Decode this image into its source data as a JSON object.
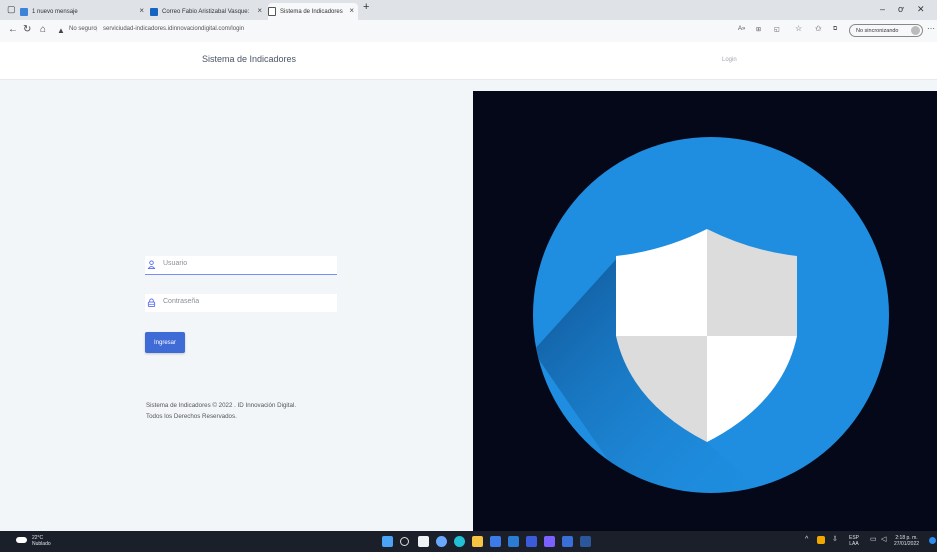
{
  "browser": {
    "tabs": [
      {
        "label": "1 nuevo mensaje",
        "active": false,
        "icon": "mail-icon"
      },
      {
        "label": "Correo Fabio Aristizabal Vasque:",
        "active": false,
        "icon": "outlook-icon"
      },
      {
        "label": "Sistema de Indicadores",
        "active": true,
        "icon": "page-icon"
      }
    ],
    "security_label": "No seguro",
    "url": "serviciudad-indicadores.idinnovaciondigital.com/login",
    "sync_label": "No sincronizando"
  },
  "header": {
    "title": "Sistema de Indicadores",
    "login_link": "Login"
  },
  "form": {
    "username_placeholder": "Usuario",
    "password_placeholder": "Contraseña",
    "submit_label": "Ingresar"
  },
  "footer": {
    "line1": "Sistema de Indicadores © 2022 . ID Innovación Digital.",
    "line2": "Todos los Derechos Reservados."
  },
  "taskbar": {
    "temperature": "22°C",
    "weather": "Nublado",
    "lang_top": "ESP",
    "lang_bottom": "LAA",
    "time": "2:18 p. m.",
    "date": "27/01/2022"
  },
  "colors": {
    "accent": "#3e6bd6",
    "hero_bg": "#050818",
    "hero_circle": "#1f8ee0",
    "shield_white": "#ffffff",
    "shield_grey": "#dcdcdc"
  }
}
